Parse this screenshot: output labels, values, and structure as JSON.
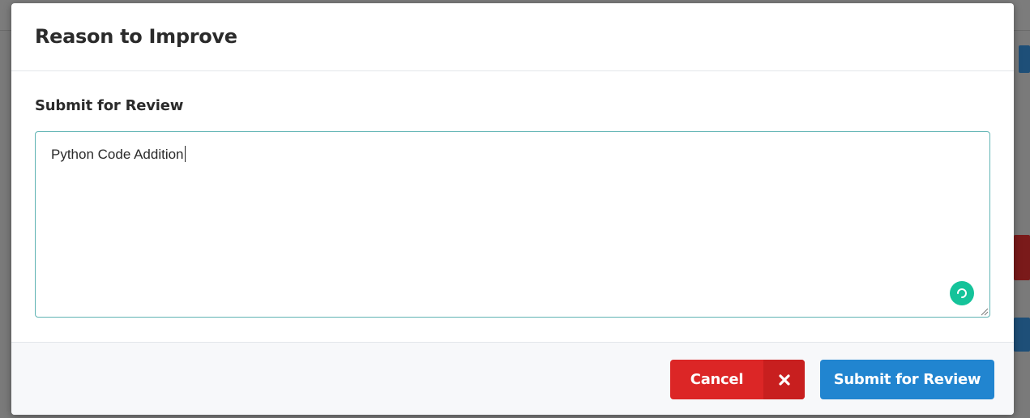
{
  "modal": {
    "title": "Reason to Improve",
    "field_label": "Submit for Review",
    "textarea_value": "Python Code Addition"
  },
  "footer": {
    "cancel_label": "Cancel",
    "cancel_icon": "close-icon",
    "submit_label": "Submit for Review"
  },
  "colors": {
    "cancel": "#dc2626",
    "submit": "#2185d0",
    "grammarly": "#15c39a",
    "focus_border": "#5fb3b3"
  }
}
